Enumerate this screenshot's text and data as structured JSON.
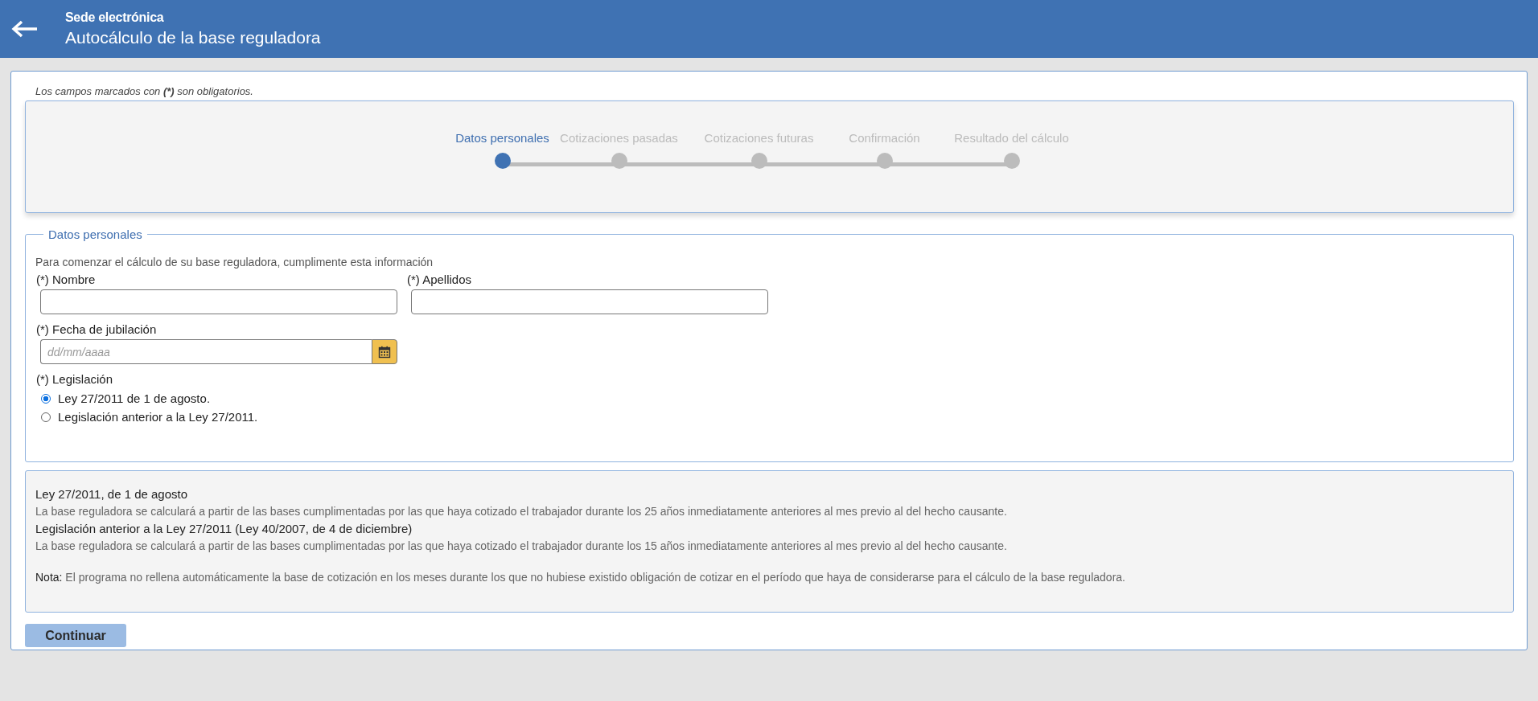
{
  "header": {
    "subtitle": "Sede electrónica",
    "title": "Autocálculo de la base reguladora"
  },
  "required_note": "Los campos marcados con **(*)** son obligatorios.",
  "steps": [
    {
      "label": "Datos personales",
      "selected": true
    },
    {
      "label": "Cotizaciones pasadas",
      "selected": false
    },
    {
      "label": "Cotizaciones futuras",
      "selected": false
    },
    {
      "label": "Confirmación",
      "selected": false
    },
    {
      "label": "Resultado del cálculo",
      "selected": false
    }
  ],
  "personal_data": {
    "legend": "Datos personales",
    "intro": "Para comenzar el cálculo de su base reguladora, cumplimente esta información",
    "fields": [
      {
        "kind": "text",
        "label": "(*) Nombre"
      },
      {
        "kind": "text",
        "label": "(*) Apellidos"
      },
      {
        "kind": "date",
        "label": "(*) Fecha de jubilación",
        "placeholder": "dd/mm/aaaa"
      }
    ],
    "legislation": {
      "label": "(*) Legislación",
      "options": [
        {
          "label": "Ley 27/2011 de 1 de agosto.",
          "selected": true
        },
        {
          "label": "Legislación anterior a la Ley 27/2011.",
          "selected": false
        }
      ]
    }
  },
  "info": [
    {
      "kind": "heading",
      "text": "Ley 27/2011, de 1 de agosto"
    },
    {
      "kind": "text",
      "text": "La base reguladora se calculará a partir de las bases cumplimentadas por las que haya cotizado el trabajador durante los 25 años inmediatamente anteriores al mes previo al del hecho causante."
    },
    {
      "kind": "heading",
      "text": "Legislación anterior a la Ley 27/2011 (Ley 40/2007, de 4 de diciembre)"
    },
    {
      "kind": "text",
      "text": "La base reguladora se calculará a partir de las bases cumplimentadas por las que haya cotizado el trabajador durante los 15 años inmediatamente anteriores al mes previo al del hecho causante."
    },
    {
      "kind": "note",
      "text": "**Nota:** El programa no rellena automáticamente la base de cotización en los meses durante los que no hubiese existido obligación de cotizar en el período que haya de considerarse para el cálculo de la base reguladora."
    }
  ],
  "continue_button": "Continuar"
}
